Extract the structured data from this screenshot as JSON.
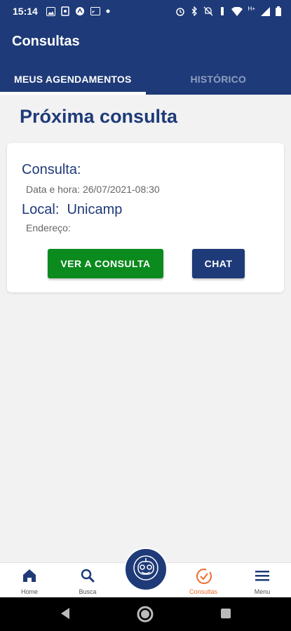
{
  "status_bar": {
    "time": "15:14",
    "network": "H+"
  },
  "app": {
    "title": "Consultas"
  },
  "tabs": [
    {
      "label": "MEUS AGENDAMENTOS",
      "active": true
    },
    {
      "label": "HISTÓRICO",
      "active": false
    }
  ],
  "section": {
    "title": "Próxima consulta"
  },
  "appointment": {
    "consulta_label": "Consulta:",
    "datetime": "Data e hora: 26/07/2021-08:30",
    "local": "Local:  Unicamp",
    "endereco": "Endereço:",
    "view_button": "VER A CONSULTA",
    "chat_button": "CHAT"
  },
  "bottom_nav": {
    "items": [
      {
        "label": "Home",
        "icon": "home-icon"
      },
      {
        "label": "Busca",
        "icon": "search-icon"
      },
      {
        "label": "",
        "icon": "robot-avatar-icon"
      },
      {
        "label": "Consultas",
        "icon": "check-circle-icon",
        "active": true
      },
      {
        "label": "Menu",
        "icon": "menu-icon"
      }
    ]
  },
  "colors": {
    "primary": "#1e3a78",
    "success": "#0b8a1d",
    "accent": "#f26a2a",
    "background": "#f2f2f2"
  }
}
